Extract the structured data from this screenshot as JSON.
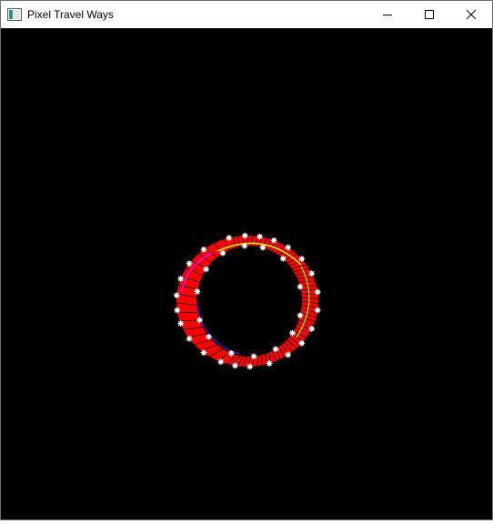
{
  "window": {
    "title": "Pixel Travel Ways",
    "app_icon": "window-app-icon",
    "controls": {
      "minimize_icon": "minimize-icon",
      "maximize_icon": "maximize-icon",
      "close_icon": "close-icon"
    }
  },
  "canvas": {
    "background": "#000000",
    "ring_fill": "#ff0000",
    "marker_color": "#ffffff",
    "edge_colors": [
      "#ffff00",
      "#7fff00",
      "#ff00ff",
      "#8000ff"
    ]
  }
}
